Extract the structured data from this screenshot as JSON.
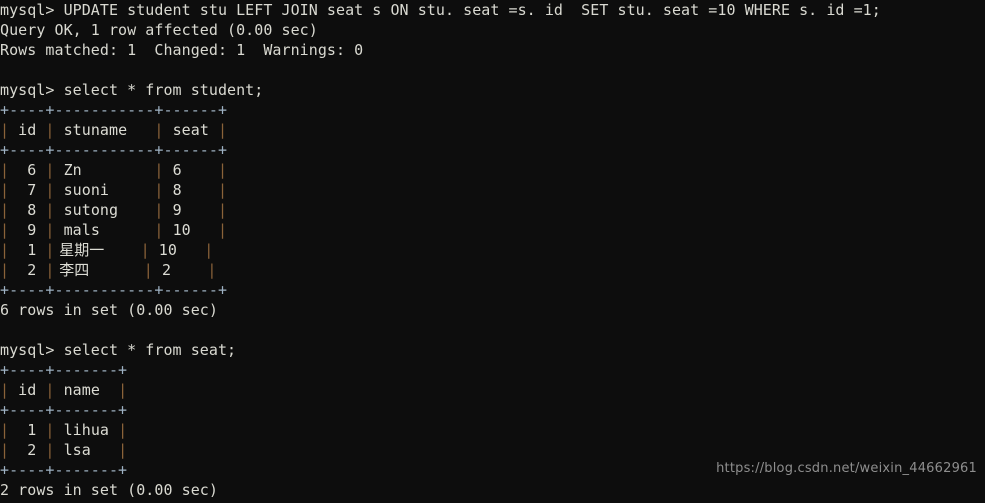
{
  "terminal": {
    "prompt": "mysql>",
    "background_color": "#0d0d0d",
    "text_color": "#d9d9d1",
    "pipe_color": "#8a6239",
    "rule_color": "#9fb2c4",
    "watermark_color": "#8e8e8e"
  },
  "watermark": {
    "text": "https://blog.csdn.net/weixin_44662961"
  },
  "blocks": {
    "update_statement": {
      "command": "mysql> UPDATE student stu LEFT JOIN seat s ON stu. seat =s. id  SET stu. seat =10 WHERE s. id =1;",
      "result_line_1": "Query OK, 1 row affected (0.00 sec)",
      "result_line_2": "Rows matched: 1  Changed: 1  Warnings: 0"
    },
    "select_student": {
      "command": "mysql> select * from student;",
      "rule_top": "+----+-----------+------+",
      "rule_mid": "+----+-----------+------+",
      "rule_bottom": "+----+-----------+------+",
      "header": {
        "id": " id ",
        "stuname": " stuname   ",
        "seat": " seat "
      },
      "rows": [
        {
          "id": "  6 ",
          "stuname": " Zn        ",
          "seat": " 6    "
        },
        {
          "id": "  7 ",
          "stuname": " suoni     ",
          "seat": " 8    "
        },
        {
          "id": "  8 ",
          "stuname": " sutong    ",
          "seat": " 9    "
        },
        {
          "id": "  9 ",
          "stuname": " mals      ",
          "seat": " 10   "
        },
        {
          "id": "  1 ",
          "stuname": " 星期一",
          "stuname_pad": "    ",
          "seat": " 10   ",
          "cjk": true
        },
        {
          "id": "  2 ",
          "stuname": " 李四",
          "stuname_pad": "      ",
          "seat": " 2    ",
          "cjk": true
        }
      ],
      "footer": "6 rows in set (0.00 sec)"
    },
    "select_seat": {
      "command": "mysql> select * from seat;",
      "rule_top": "+----+-------+",
      "rule_mid": "+----+-------+",
      "rule_bottom": "+----+-------+",
      "header": {
        "id": " id ",
        "name": " name  "
      },
      "rows": [
        {
          "id": "  1 ",
          "name": " lihua "
        },
        {
          "id": "  2 ",
          "name": " lsa   "
        }
      ],
      "footer": "2 rows in set (0.00 sec)"
    }
  }
}
